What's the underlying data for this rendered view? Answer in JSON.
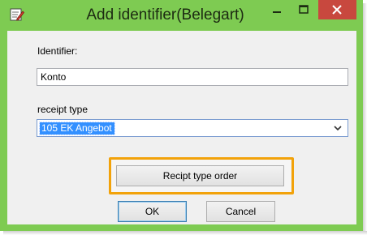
{
  "window": {
    "title": "Add identifier(Belegart)"
  },
  "form": {
    "identifier_label": "Identifier:",
    "identifier_value": "Konto",
    "receipt_type_label": "receipt type",
    "receipt_type_value": "105  EK Angebot"
  },
  "buttons": {
    "receipt_type_order": "Recipt type order",
    "ok": "OK",
    "cancel": "Cancel"
  },
  "icons": {
    "app": "edit-document-icon",
    "minimize": "minimize-icon",
    "maximize": "maximize-icon",
    "close": "close-icon",
    "dropdown": "chevron-down-icon"
  },
  "colors": {
    "titlebar": "#7ecb52",
    "close_button": "#c8483e",
    "highlight_border": "#f2a20a",
    "selection": "#3390ff"
  }
}
